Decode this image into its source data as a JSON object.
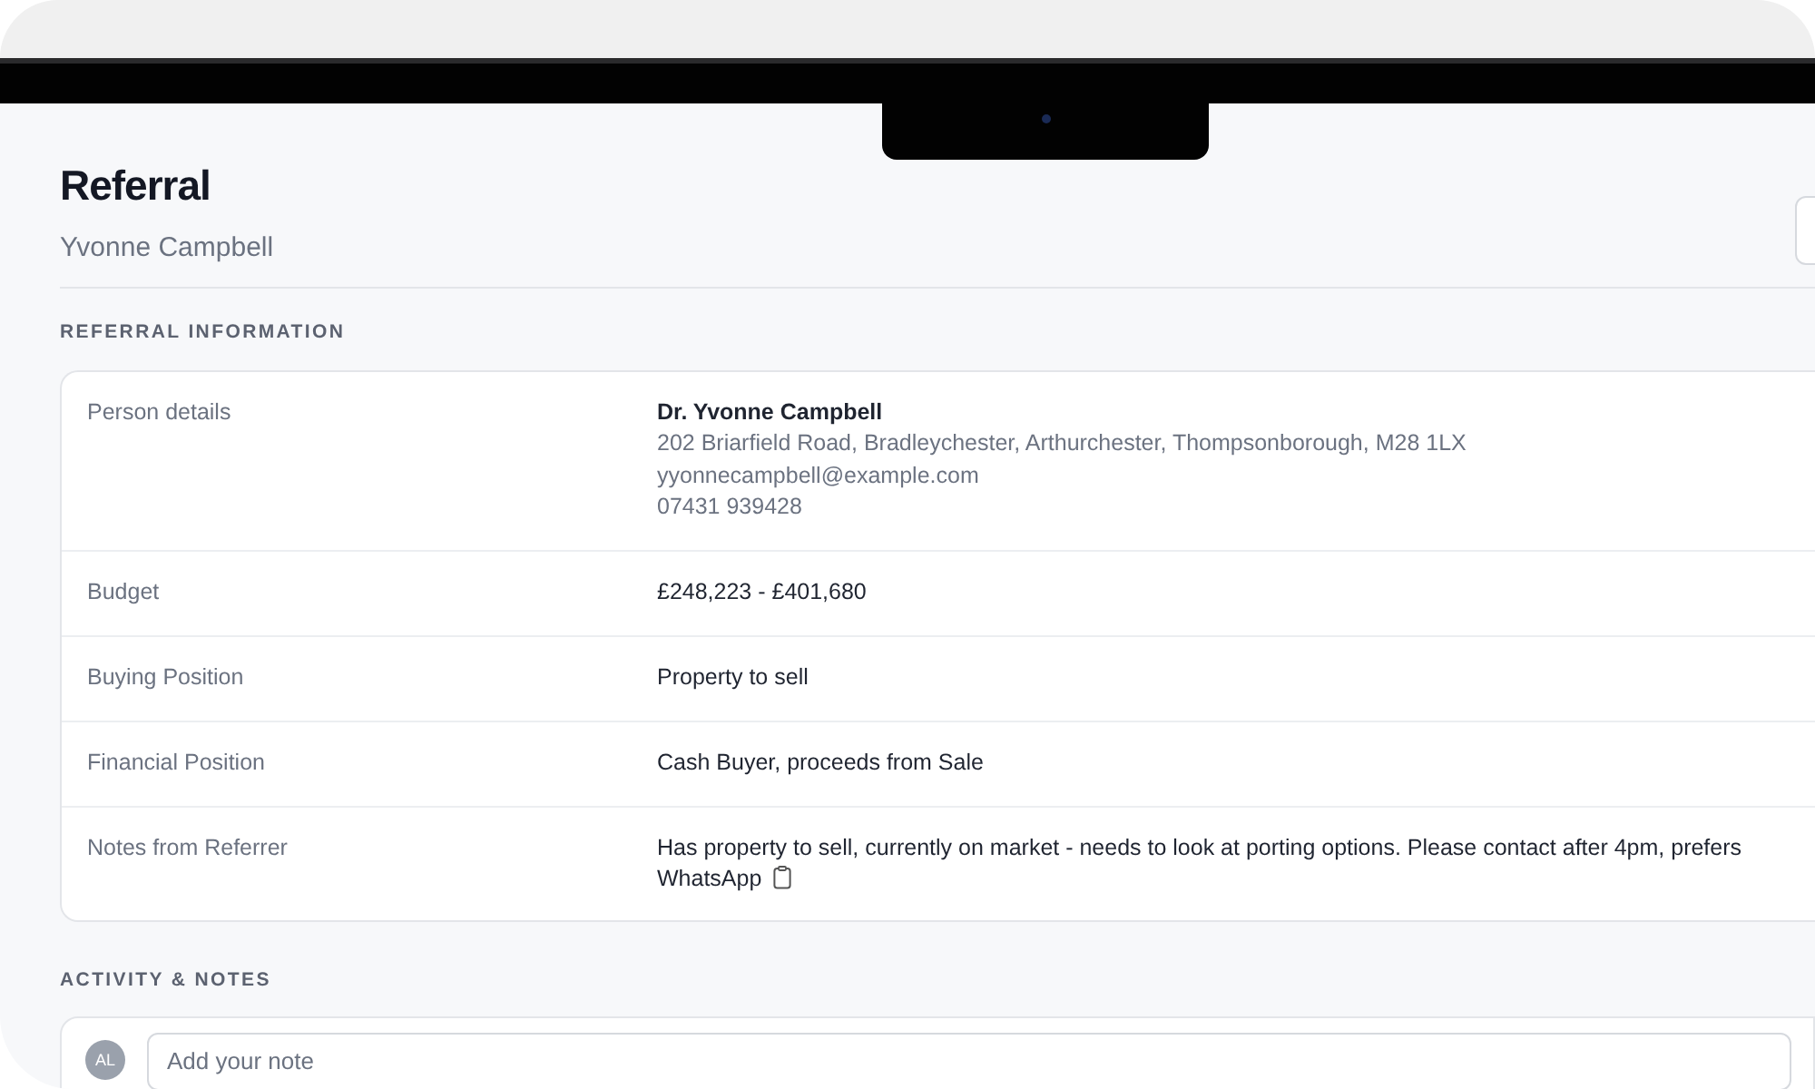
{
  "page": {
    "title": "Referral",
    "subtitle": "Yvonne Campbell"
  },
  "referral_information": {
    "heading": "REFERRAL INFORMATION",
    "rows": [
      {
        "kind": "person",
        "label": "Person details",
        "name": "Dr. Yvonne Campbell",
        "lines": [
          "202 Briarfield Road, Bradleychester, Arthurchester, Thompsonborough, M28 1LX",
          "yyonnecampbell@example.com",
          "07431 939428"
        ]
      },
      {
        "kind": "text",
        "label": "Budget",
        "value": "£248,223 - £401,680"
      },
      {
        "kind": "text",
        "label": "Buying Position",
        "value": "Property to sell"
      },
      {
        "kind": "text",
        "label": "Financial Position",
        "value": "Cash Buyer, proceeds from Sale"
      },
      {
        "kind": "text",
        "label": "Notes from Referrer",
        "value": "Has property to sell, currently on market - needs to look at porting options. Please contact after 4pm, prefers WhatsApp",
        "copyable": true
      }
    ]
  },
  "activity": {
    "heading": "ACTIVITY & NOTES",
    "avatar": "AL",
    "note": {
      "placeholder": "Add your note"
    }
  }
}
